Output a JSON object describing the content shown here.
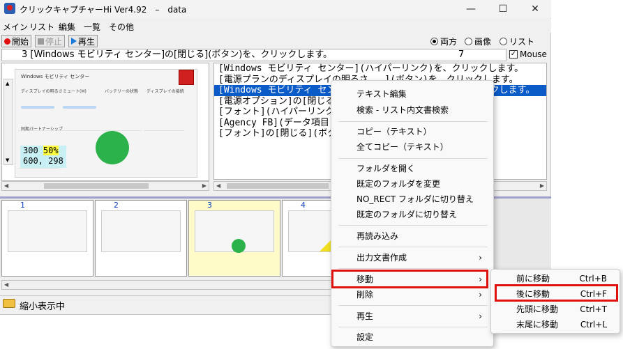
{
  "window": {
    "title": "クリックキャプチャーHi Ver4.92　–　data"
  },
  "menubar": [
    "メイン",
    "リスト",
    "編集",
    "一覧",
    "その他"
  ],
  "toolbar": {
    "start": "開始",
    "stop": "停止",
    "play": "再生"
  },
  "view_options": {
    "both": "両方",
    "image": "画像",
    "list": "リスト",
    "selected": "both"
  },
  "command": {
    "text": "3 [Windows モビリティ センター]の[閉じる](ボタン)を、クリックします。",
    "count": "7"
  },
  "mouse_check": {
    "label": "Mouse",
    "checked": true
  },
  "preview": {
    "title": "Windows モビリティ センター",
    "tiles": [
      "ディスプレイの明るさ",
      "ミュート(M)",
      "バッテリーの状態",
      "ディスプレイの接続",
      "同期パートナーシップ"
    ],
    "coords_x": "300",
    "coords_pct": "50%",
    "coords_xy": "600, 298"
  },
  "list_rows": [
    "[Windows モビリティ センター](ハイパーリンク)を、クリックします。",
    "[電源プランのディスプレイの明るさ...](ボタン)を、クリックします。",
    "[Windows モビリティ センター]の[閉じる](ボタン)を、クリックします。",
    "[電源オプション]の[閉じる](ボタン)を、",
    "[フォント](ハイパーリンク)を、",
    "[Agency FB](データ項目)を、",
    "[フォント]の[閉じる](ボタン)を、"
  ],
  "thumbnails": [
    "1",
    "2",
    "3",
    "4"
  ],
  "status": {
    "text": "縮小表示中"
  },
  "context_menu": {
    "items": [
      "テキスト編集",
      "検索 - リスト内文書検索",
      "コピー（テキスト）",
      "全てコピー（テキスト）",
      "フォルダを開く",
      "既定のフォルダを変更",
      "NO_RECT フォルダに切り替え",
      "既定のフォルダに切り替え",
      "再読み込み",
      "出力文書作成",
      "移動",
      "削除",
      "再生",
      "設定"
    ]
  },
  "submenu": {
    "items": [
      {
        "label": "前に移動",
        "key": "Ctrl+B"
      },
      {
        "label": "後に移動",
        "key": "Ctrl+F"
      },
      {
        "label": "先頭に移動",
        "key": "Ctrl+T"
      },
      {
        "label": "末尾に移動",
        "key": "Ctrl+L"
      }
    ]
  },
  "colors": {
    "highlight": "#e01010",
    "selection": "#0a5ac8"
  }
}
